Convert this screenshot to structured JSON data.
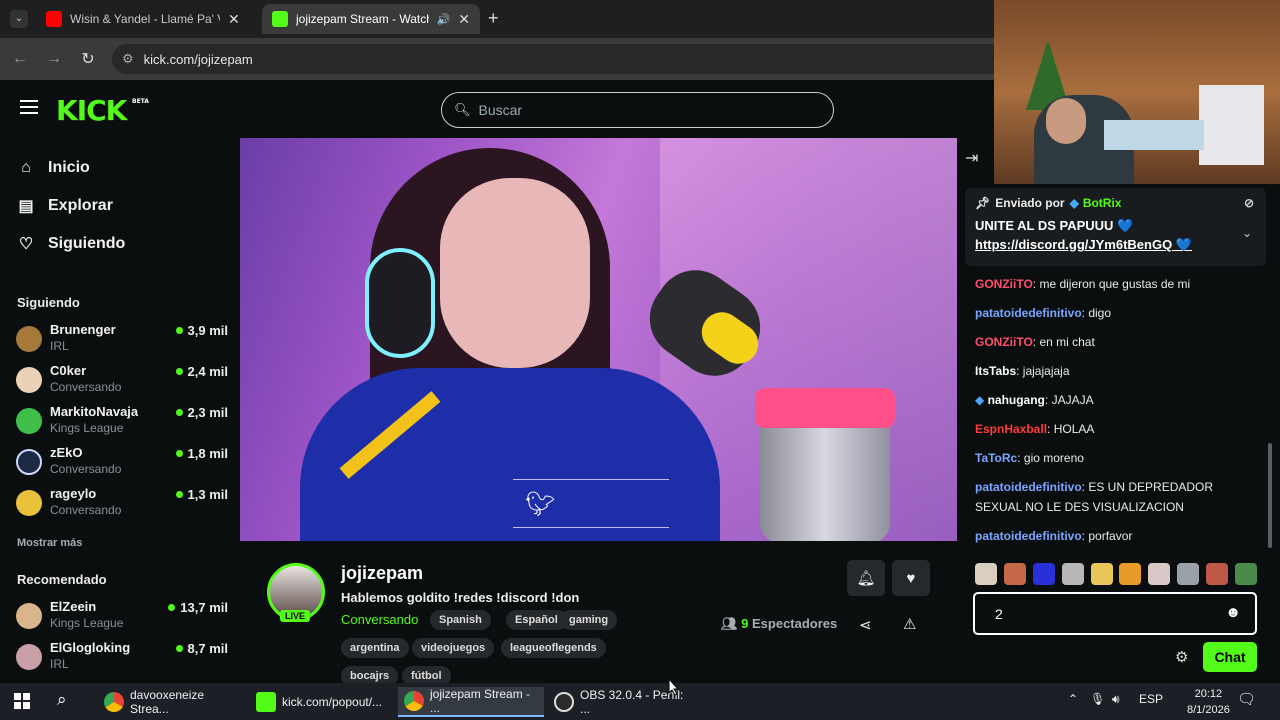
{
  "browser": {
    "tabs": [
      {
        "label": "Wisin & Yandel - Llamé Pa' Verte",
        "icon": "youtube-icon",
        "active": false
      },
      {
        "label": "jojizepam Stream - Watch Live on Kick",
        "icon": "kick-icon",
        "active": true
      }
    ],
    "new_tab": "+",
    "url": "kick.com/jojizepam"
  },
  "header": {
    "logo": "KICK",
    "logo_badge": "BETA",
    "search_placeholder": "Buscar"
  },
  "sidebar": {
    "nav": [
      {
        "label": "Inicio",
        "icon": "home-icon"
      },
      {
        "label": "Explorar",
        "icon": "explore-icon"
      },
      {
        "label": "Siguiendo",
        "icon": "heart-icon"
      }
    ],
    "following_title": "Siguiendo",
    "following": [
      {
        "name": "Brunenger",
        "category": "IRL",
        "viewers": "3,9 mil"
      },
      {
        "name": "C0ker",
        "category": "Conversando",
        "viewers": "2,4 mil"
      },
      {
        "name": "MarkitoNavaja",
        "category": "Kings League",
        "viewers": "2,3 mil"
      },
      {
        "name": "zEkO",
        "category": "Conversando",
        "viewers": "1,8 mil"
      },
      {
        "name": "rageylo",
        "category": "Conversando",
        "viewers": "1,3 mil"
      }
    ],
    "show_more": "Mostrar más",
    "recommended_title": "Recomendado",
    "recommended": [
      {
        "name": "ElZeein",
        "category": "Kings League",
        "viewers": "13,7 mil"
      },
      {
        "name": "ElGlogloking",
        "category": "IRL",
        "viewers": "8,7 mil"
      }
    ]
  },
  "stream": {
    "channel": "jojizepam",
    "live_badge": "LIVE",
    "title": "Hablemos goldito !redes !discord !don",
    "category": "Conversando",
    "tags": [
      "Spanish",
      "Español",
      "gaming",
      "argentina",
      "videojuegos",
      "leagueoflegends",
      "bocajrs",
      "fútbol"
    ],
    "viewers_count": "9",
    "viewers_label": "Espectadores"
  },
  "chat": {
    "pinned": {
      "sent_by": "Enviado por",
      "bot": "BotRix",
      "message": "UNITE AL DS PAPUUU 💙",
      "link": "https://discord.gg/JYm6tBenGQ 💙"
    },
    "messages": [
      {
        "user": "GONZiiTO",
        "color": "#ff4f6d",
        "text": "me dijeron que gustas de mi"
      },
      {
        "user": "patatoidedefinitivo",
        "color": "#7aa6ff",
        "text": "digo"
      },
      {
        "user": "GONZiiTO",
        "color": "#ff4f6d",
        "text": "en mi chat"
      },
      {
        "user": "ItsTabs",
        "color": "#ffffff",
        "text": "jajajajaja"
      },
      {
        "user": "nahugang",
        "color": "#ffffff",
        "text": "JAJAJA"
      },
      {
        "user": "EspnHaxball",
        "color": "#ff3b3b",
        "text": "HOLAA"
      },
      {
        "user": "TaToRc",
        "color": "#7aa6ff",
        "text": "gio moreno"
      },
      {
        "user": "patatoidedefinitivo",
        "color": "#7aa6ff",
        "text": "ES UN DEPREDADOR SEXUAL NO LE DES VISUALIZACION"
      },
      {
        "user": "patatoidedefinitivo",
        "color": "#7aa6ff",
        "text": "porfavor"
      }
    ],
    "input_value": "2",
    "send_label": "Chat"
  },
  "taskbar": {
    "items": [
      {
        "label": "davooxeneize Strea..."
      },
      {
        "label": "kick.com/popout/..."
      },
      {
        "label": "jojizepam Stream - ..."
      },
      {
        "label": "OBS 32.0.4 - Perfil: ..."
      }
    ],
    "lang": "ESP",
    "time": "20:12",
    "date": "8/1/2026"
  },
  "colors": {
    "accent": "#53fc18",
    "background": "#0b0e0f"
  }
}
